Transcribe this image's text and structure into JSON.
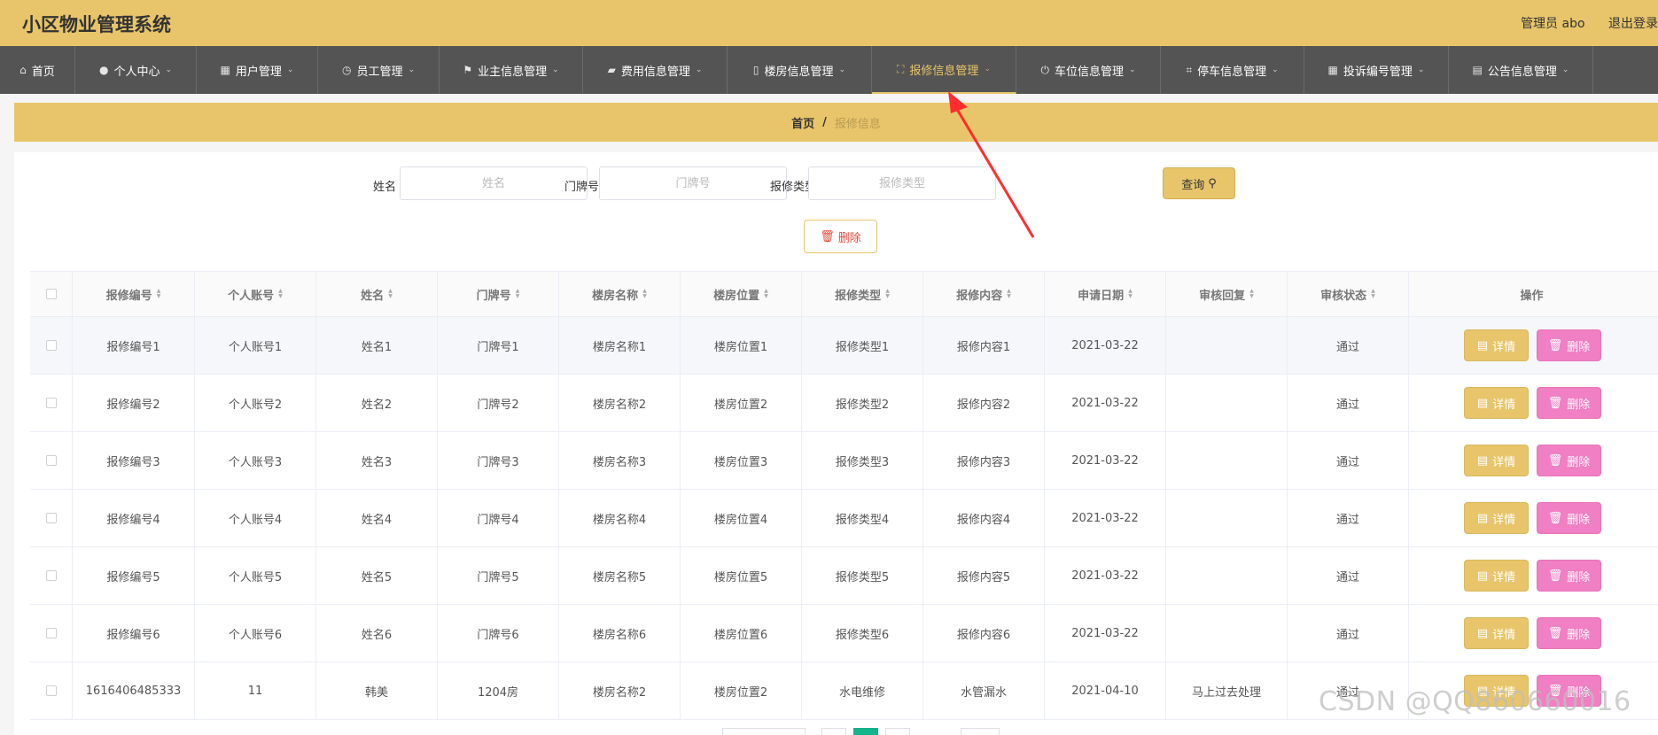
{
  "app": {
    "title": "小区物业管理系统",
    "admin_label": "管理员 abo",
    "logout_label": "退出登录"
  },
  "nav": [
    {
      "label": "首页",
      "icon": "home-icon",
      "glyph": "⌂",
      "caret": false,
      "active": false
    },
    {
      "label": "个人中心",
      "icon": "user-icon",
      "glyph": "●",
      "caret": true,
      "active": false
    },
    {
      "label": "用户管理",
      "icon": "grid-icon",
      "glyph": "▦",
      "caret": true,
      "active": false
    },
    {
      "label": "员工管理",
      "icon": "clock-icon",
      "glyph": "◷",
      "caret": true,
      "active": false
    },
    {
      "label": "业主信息管理",
      "icon": "flag-icon",
      "glyph": "⚑",
      "caret": true,
      "active": false
    },
    {
      "label": "费用信息管理",
      "icon": "wallet-icon",
      "glyph": "▰",
      "caret": true,
      "active": false
    },
    {
      "label": "楼房信息管理",
      "icon": "building-icon",
      "glyph": "▯",
      "caret": true,
      "active": false
    },
    {
      "label": "报修信息管理",
      "icon": "scan-icon",
      "glyph": "⛶",
      "caret": true,
      "active": true
    },
    {
      "label": "车位信息管理",
      "icon": "power-icon",
      "glyph": "⏻",
      "caret": true,
      "active": false
    },
    {
      "label": "停车信息管理",
      "icon": "crop-icon",
      "glyph": "⌗",
      "caret": true,
      "active": false
    },
    {
      "label": "投诉编号管理",
      "icon": "apps-icon",
      "glyph": "▦",
      "caret": true,
      "active": false
    },
    {
      "label": "公告信息管理",
      "icon": "briefcase-icon",
      "glyph": "▤",
      "caret": true,
      "active": false
    }
  ],
  "breadcrumb": {
    "home": "首页",
    "separator": "/",
    "current": "报修信息"
  },
  "search": {
    "name_label": "姓名",
    "name_placeholder": "姓名",
    "door_label": "门牌号",
    "door_placeholder": "门牌号",
    "type_label": "报修类型",
    "type_placeholder": "报修类型",
    "query_label": "查询"
  },
  "batch_delete_label": "删除",
  "table": {
    "columns": [
      "报修编号",
      "个人账号",
      "姓名",
      "门牌号",
      "楼房名称",
      "楼房位置",
      "报修类型",
      "报修内容",
      "申请日期",
      "审核回复",
      "审核状态",
      "操作"
    ],
    "rows": [
      [
        "报修编号1",
        "个人账号1",
        "姓名1",
        "门牌号1",
        "楼房名称1",
        "楼房位置1",
        "报修类型1",
        "报修内容1",
        "2021-03-22",
        "",
        "通过"
      ],
      [
        "报修编号2",
        "个人账号2",
        "姓名2",
        "门牌号2",
        "楼房名称2",
        "楼房位置2",
        "报修类型2",
        "报修内容2",
        "2021-03-22",
        "",
        "通过"
      ],
      [
        "报修编号3",
        "个人账号3",
        "姓名3",
        "门牌号3",
        "楼房名称3",
        "楼房位置3",
        "报修类型3",
        "报修内容3",
        "2021-03-22",
        "",
        "通过"
      ],
      [
        "报修编号4",
        "个人账号4",
        "姓名4",
        "门牌号4",
        "楼房名称4",
        "楼房位置4",
        "报修类型4",
        "报修内容4",
        "2021-03-22",
        "",
        "通过"
      ],
      [
        "报修编号5",
        "个人账号5",
        "姓名5",
        "门牌号5",
        "楼房名称5",
        "楼房位置5",
        "报修类型5",
        "报修内容5",
        "2021-03-22",
        "",
        "通过"
      ],
      [
        "报修编号6",
        "个人账号6",
        "姓名6",
        "门牌号6",
        "楼房名称6",
        "楼房位置6",
        "报修类型6",
        "报修内容6",
        "2021-03-22",
        "",
        "通过"
      ],
      [
        "1616406485333",
        "11",
        "韩美",
        "1204房",
        "楼房名称2",
        "楼房位置2",
        "水电维修",
        "水管漏水",
        "2021-04-10",
        "马上过去处理",
        "通过"
      ]
    ],
    "detail_label": "详情",
    "delete_label": "删除"
  },
  "watermark": "CSDN @QQ860660016",
  "colors": {
    "accent": "#e8c56a",
    "nav_bg": "#545454",
    "delete_pink": "#f07fc3",
    "arrow_red": "#ff2d2d",
    "page_active": "#15b38a"
  }
}
